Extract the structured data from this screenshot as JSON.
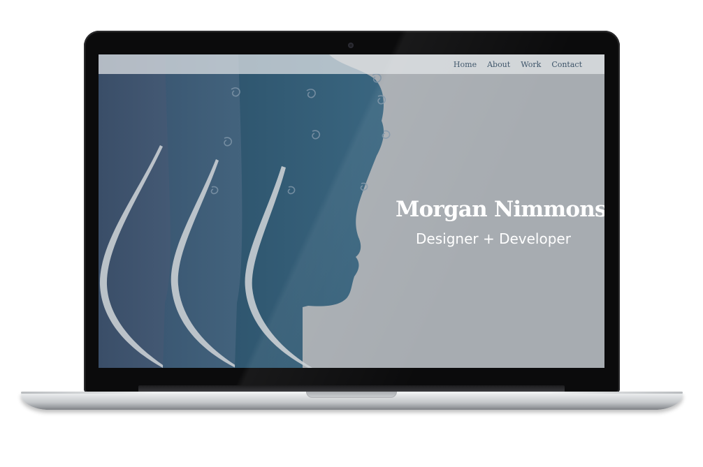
{
  "site": {
    "nav": {
      "items": [
        "Home",
        "About",
        "Work",
        "Contact"
      ]
    },
    "hero": {
      "title": "Morgan Nimmons",
      "subtitle": "Designer + Developer"
    }
  },
  "colors": {
    "screen_background": "#a7acb1",
    "nav_text": "#3c5368",
    "silhouette_back": "#3f5570",
    "silhouette_mid": "#3f6078",
    "silhouette_front": "#2f5670",
    "hero_text": "#ffffff",
    "navbar_background": "#e2e5e8"
  },
  "icons": {
    "camera": "webcam-icon"
  }
}
